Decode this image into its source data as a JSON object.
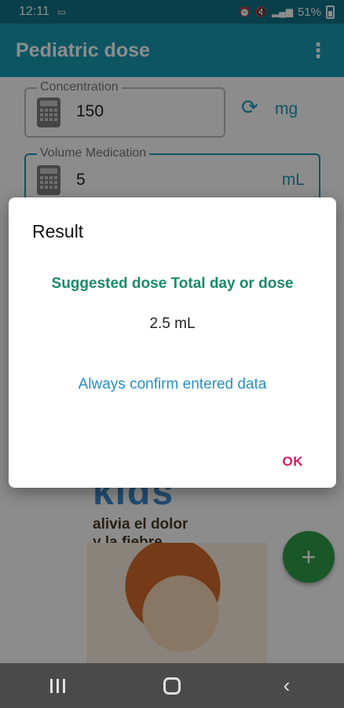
{
  "status_bar": {
    "time": "12:11",
    "battery": "51%",
    "icons": [
      "notification-icon",
      "alarm-icon",
      "mute-icon",
      "wifi-icon",
      "signal-icon",
      "battery-icon"
    ]
  },
  "app_bar": {
    "title": "Pediatric dose",
    "menu_icon": "more-vert-icon"
  },
  "form": {
    "concentration": {
      "label": "Concentration",
      "value": "150",
      "unit": "mg"
    },
    "volume": {
      "label": "Volume Medication",
      "value": "5",
      "unit": "mL"
    }
  },
  "ad": {
    "brand_partial": "kids",
    "line1": "alivia el dolor",
    "line2": "y la fiebre"
  },
  "fab": {
    "symbol": "+"
  },
  "dialog": {
    "title": "Result",
    "heading": "Suggested dose Total day or dose",
    "result": "2.5 mL",
    "note": "Always confirm entered data",
    "ok": "OK"
  },
  "colors": {
    "primary": "#1a9bb2",
    "primary_dark": "#0f7487",
    "heading": "#1b8a6b",
    "note": "#2a8fc2",
    "ok": "#d81b60",
    "fab": "#2e9e4a"
  }
}
